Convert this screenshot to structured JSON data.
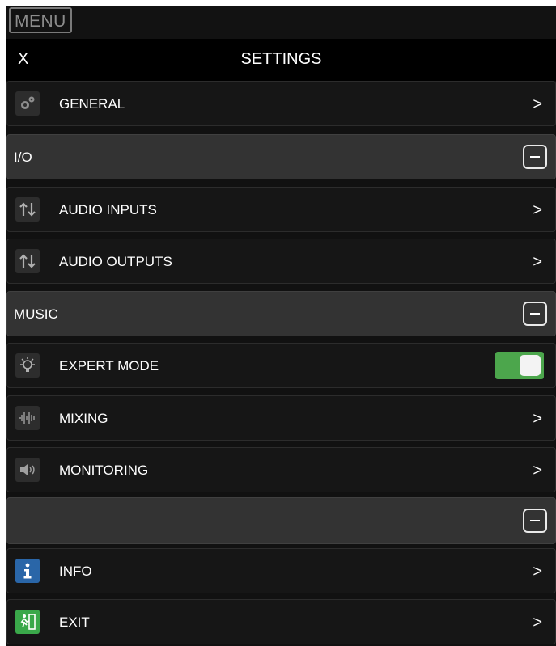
{
  "menu": {
    "label": "MENU"
  },
  "header": {
    "close_label": "X",
    "title": "SETTINGS"
  },
  "rows": [
    {
      "label": "GENERAL",
      "chevron": ">",
      "icon": "gears-icon"
    },
    {
      "label": "I/O",
      "type": "section"
    },
    {
      "label": "AUDIO INPUTS",
      "chevron": ">",
      "icon": "arrows-updown-icon"
    },
    {
      "label": "AUDIO OUTPUTS",
      "chevron": ">",
      "icon": "arrows-updown-icon"
    },
    {
      "label": "MUSIC",
      "type": "section"
    },
    {
      "label": "EXPERT MODE",
      "icon": "lightbulb-icon",
      "toggle_on": true
    },
    {
      "label": "MIXING",
      "chevron": ">",
      "icon": "waveform-icon"
    },
    {
      "label": "MONITORING",
      "chevron": ">",
      "icon": "speaker-icon"
    },
    {
      "label": "",
      "type": "section"
    },
    {
      "label": "INFO",
      "chevron": ">",
      "icon": "info-icon"
    },
    {
      "label": "EXIT",
      "chevron": ">",
      "icon": "exit-icon"
    }
  ],
  "colors": {
    "toggle_on": "#4ca64c",
    "info_icon_bg": "#2a66a8",
    "exit_icon_bg": "#3aa84a"
  }
}
